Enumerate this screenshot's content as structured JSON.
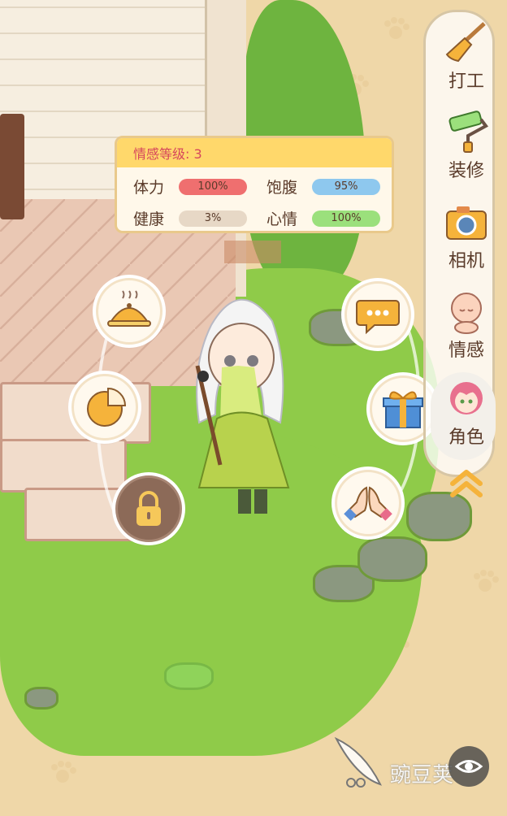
{
  "status_panel": {
    "title": "情感等级: 3",
    "stats": [
      {
        "label": "体力",
        "value": "100%",
        "color": "#ef6f6f"
      },
      {
        "label": "饱腹",
        "value": "95%",
        "color": "#8ec8ee"
      },
      {
        "label": "健康",
        "value": "3%",
        "color": "#e7d8c6"
      },
      {
        "label": "心情",
        "value": "100%",
        "color": "#9be07c"
      }
    ]
  },
  "radial_actions": [
    {
      "name": "feed-button",
      "icon": "food-cloche-icon"
    },
    {
      "name": "stats-button",
      "icon": "pie-chart-icon"
    },
    {
      "name": "locked-button",
      "icon": "lock-icon"
    },
    {
      "name": "chat-button",
      "icon": "speech-bubble-icon"
    },
    {
      "name": "gift-button",
      "icon": "gift-box-icon"
    },
    {
      "name": "pray-button",
      "icon": "praying-hands-icon"
    }
  ],
  "side_menu": {
    "items": [
      {
        "label": "打工",
        "icon": "broom-icon"
      },
      {
        "label": "装修",
        "icon": "paint-roller-icon"
      },
      {
        "label": "相机",
        "icon": "camera-icon"
      },
      {
        "label": "情感",
        "icon": "baby-face-icon"
      },
      {
        "label": "角色",
        "icon": "character-avatar-icon"
      }
    ],
    "collapse_icon": "double-chevron-up-icon"
  },
  "watermark": {
    "text": "豌豆荚"
  },
  "colors": {
    "accent": "#ffd86b",
    "title_text": "#d6465c",
    "menu_text": "#5a3b2a"
  }
}
